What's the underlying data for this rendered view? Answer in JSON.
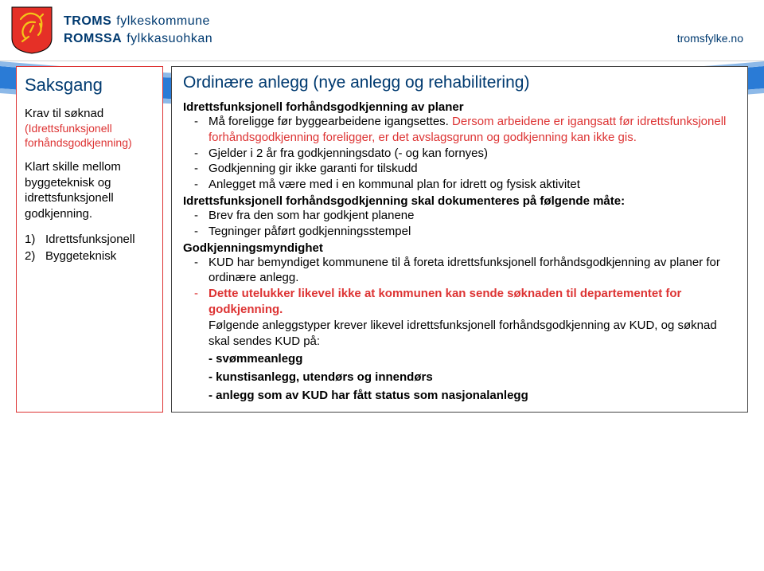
{
  "header": {
    "brand_strong_1": "TROMS",
    "brand_light_1": "fylkeskommune",
    "brand_strong_2": "ROMSSA",
    "brand_light_2": "fylkkasuohkan",
    "site_url": "tromsfylke.no"
  },
  "left": {
    "title": "Saksgang",
    "sub_head": "Krav til søknad",
    "paren_1": "(Idrettsfunksjonell",
    "paren_2": "forhåndsgodkjenning)",
    "para": "Klart skille mellom byggeteknisk og idrettsfunksjonell godkjenning.",
    "list": [
      {
        "num": "1)",
        "text": "Idrettsfunksjonell"
      },
      {
        "num": "2)",
        "text": "Byggeteknisk"
      }
    ]
  },
  "right": {
    "title": "Ordinære anlegg (nye anlegg og rehabilitering)",
    "sub_head_1": "Idrettsfunksjonell forhåndsgodkjenning av planer",
    "bullet_1_pre": "Må foreligge før byggearbeidene igangsettes. ",
    "bullet_1_red": "Dersom arbeidene er igangsatt før idrettsfunksjonell forhåndsgodkjenning foreligger, er det avslagsgrunn og godkjenning kan ikke gis.",
    "bullet_2": "Gjelder i 2 år fra godkjenningsdato (- og kan fornyes)",
    "bullet_3": "Godkjenning gir ikke garanti for tilskudd",
    "bullet_4": "Anlegget må være med i en kommunal plan for idrett og fysisk aktivitet",
    "sub_head_2": "Idrettsfunksjonell forhåndsgodkjenning skal dokumenteres på følgende måte:",
    "bullet_5": "Brev fra den som har godkjent planene",
    "bullet_6": "Tegninger påført godkjenningsstempel",
    "sub_head_3": "Godkjenningsmyndighet",
    "bullet_7": "KUD har bemyndiget kommunene til å foreta idrettsfunksjonell forhåndsgodkjenning av planer for ordinære anlegg.",
    "bullet_8_red": "Dette utelukker likevel ikke at kommunen kan sende søknaden til departementet for godkjenning.",
    "after_8": "Følgende anleggstyper krever likevel idrettsfunksjonell forhåndsgodkjenning av KUD, og søknad skal sendes KUD på:",
    "sub_a": "- svømmeanlegg",
    "sub_b": "- kunstisanlegg, utendørs og innendørs",
    "sub_c": "- anlegg som av KUD har fått status som nasjonalanlegg"
  }
}
